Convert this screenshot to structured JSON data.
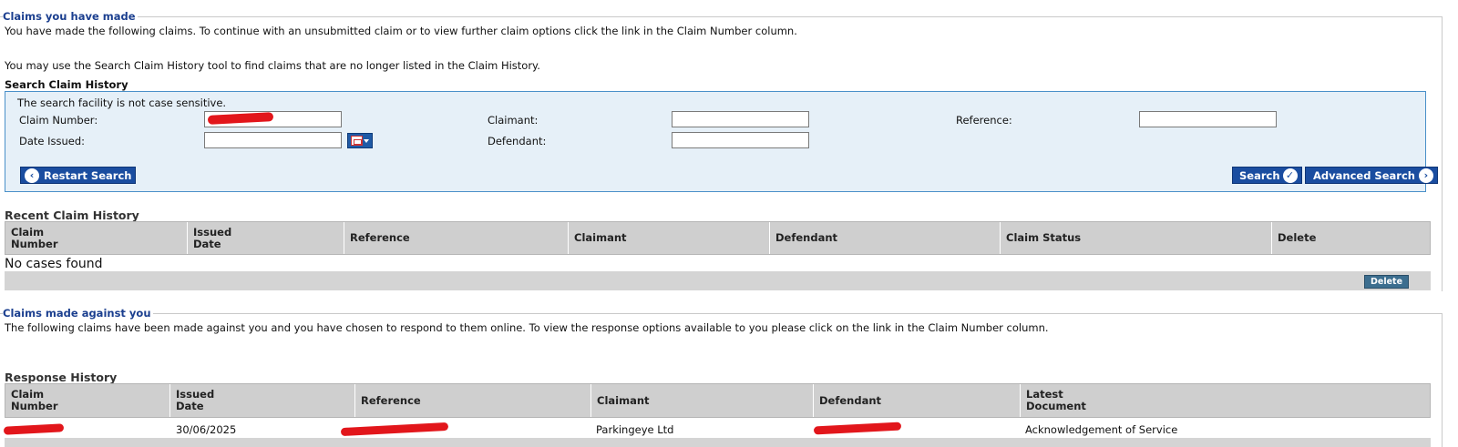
{
  "claims_made": {
    "legend": "Claims you have made",
    "intro": "You have made the following claims. To continue with an unsubmitted claim or to view further claim options click the link in the Claim Number column.",
    "search_tool_note": "You may use the Search Claim History tool to find claims that are no longer listed in the Claim History.",
    "search": {
      "heading": "Search Claim History",
      "note": "The search facility is not case sensitive.",
      "claim_number_label": "Claim Number:",
      "claim_number_value": "",
      "claimant_label": "Claimant:",
      "claimant_value": "",
      "reference_label": "Reference:",
      "reference_value": "",
      "date_issued_label": "Date Issued:",
      "date_issued_value": "",
      "defendant_label": "Defendant:",
      "defendant_value": "",
      "restart_label": "Restart Search",
      "search_label": "Search",
      "advanced_label": "Advanced Search"
    },
    "history": {
      "title": "Recent Claim History",
      "columns": [
        "Claim Number",
        "Issued Date",
        "Reference",
        "Claimant",
        "Defendant",
        "Claim Status",
        "Delete"
      ],
      "empty_message": "No cases found",
      "delete_label": "Delete"
    }
  },
  "claims_against": {
    "legend": "Claims made against you",
    "intro": "The following claims have been made against you and you have chosen to respond to them online. To view the response options available to you please click on the link in the Claim Number column.",
    "history": {
      "title": "Response History",
      "columns": [
        "Claim Number",
        "Issued Date",
        "Reference",
        "Claimant",
        "Defendant",
        "Latest Document"
      ],
      "rows": [
        {
          "claim_number": "",
          "issued_date": "30/06/2025",
          "reference": "",
          "claimant": "Parkingeye Ltd",
          "defendant": "",
          "latest_document": "Acknowledgement of Service"
        }
      ]
    }
  },
  "colors": {
    "legend": "#1b3f8f",
    "button": "#1a4da0",
    "panel_bg": "#e6f0f8",
    "panel_border": "#4a90c9",
    "header_bg": "#cfcfcf",
    "redaction": "#e2161b"
  },
  "icons": {
    "calendar": "calendar-icon",
    "restart": "chevron-left-circle-icon",
    "search": "check-circle-icon",
    "advanced": "chevron-right-circle-icon"
  }
}
